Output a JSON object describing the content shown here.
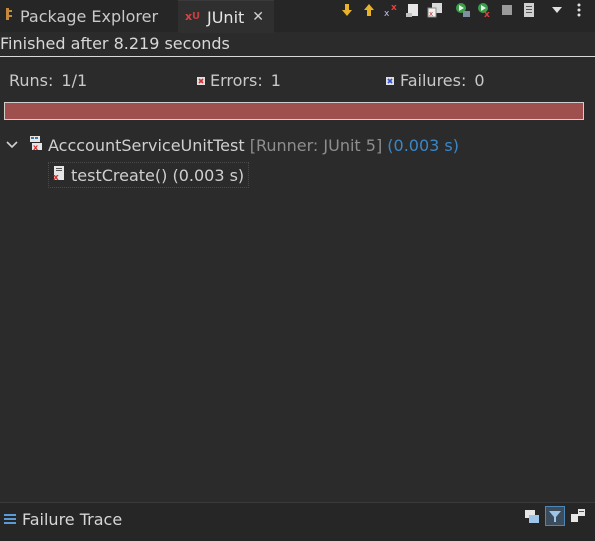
{
  "tabs": {
    "package_explorer": "Package Explorer",
    "junit": "JUnit",
    "close": "✕"
  },
  "status": "Finished after 8.219 seconds",
  "counters": {
    "runs_label": "Runs:",
    "runs_value": "1/1",
    "errors_label": "Errors:",
    "errors_value": "1",
    "failures_label": "Failures:",
    "failures_value": "0"
  },
  "progress": {
    "color": "#a04f4f",
    "fraction": 1.0
  },
  "tree": {
    "suite_name": "AcccountServiceUnitTest",
    "suite_runner": "[Runner: JUnit 5]",
    "suite_time": "(0.003 s)",
    "test_label": "testCreate() (0.003 s)"
  },
  "failure_trace": {
    "title": "Failure Trace"
  },
  "icons": [
    "package-icon",
    "junit-icon",
    "next-failure-icon",
    "previous-failure-icon",
    "show-failures-only-icon",
    "scroll-lock-icon",
    "history-icon",
    "rerun-icon",
    "rerun-failed-icon",
    "stop-icon",
    "layout-icon",
    "view-menu-icon",
    "more-icon",
    "suite-icon",
    "test-error-icon",
    "failure-trace-icon",
    "compare-icon",
    "filter-stack-icon",
    "copy-trace-icon"
  ]
}
